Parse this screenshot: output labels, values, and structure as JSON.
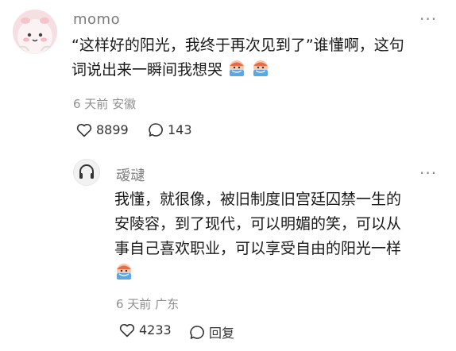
{
  "comment": {
    "username": "momo",
    "text_line1": "“这样好的阳光，我终于再次见到了”谁懂啊，这句",
    "text_line2": "词说出来一瞬间我想哭",
    "emojis": [
      "crying-emoji",
      "crying-emoji"
    ],
    "time": "6 天前",
    "location": "安徽",
    "likes": "8899",
    "replies": "143"
  },
  "reply": {
    "username": "叆叇",
    "text_lines": [
      "我懂，就很像，被旧制度旧宫廷囚禁一生的",
      "安陵容，到了现代，可以明媚的笑，可以从",
      "事自己喜欢职业，可以享受自由的阳光一样"
    ],
    "emojis": [
      "crying-emoji"
    ],
    "time": "6 天前",
    "location": "广东",
    "likes": "4233",
    "reply_label": "回复"
  },
  "icons": {
    "more": "more-dots-icon",
    "like": "heart-icon",
    "comment": "speech-bubble-icon"
  },
  "colors": {
    "meta": "#8f8f8f",
    "avatar_bg": "#f6dfe3",
    "emoji_blue": "#5aa7e8"
  }
}
